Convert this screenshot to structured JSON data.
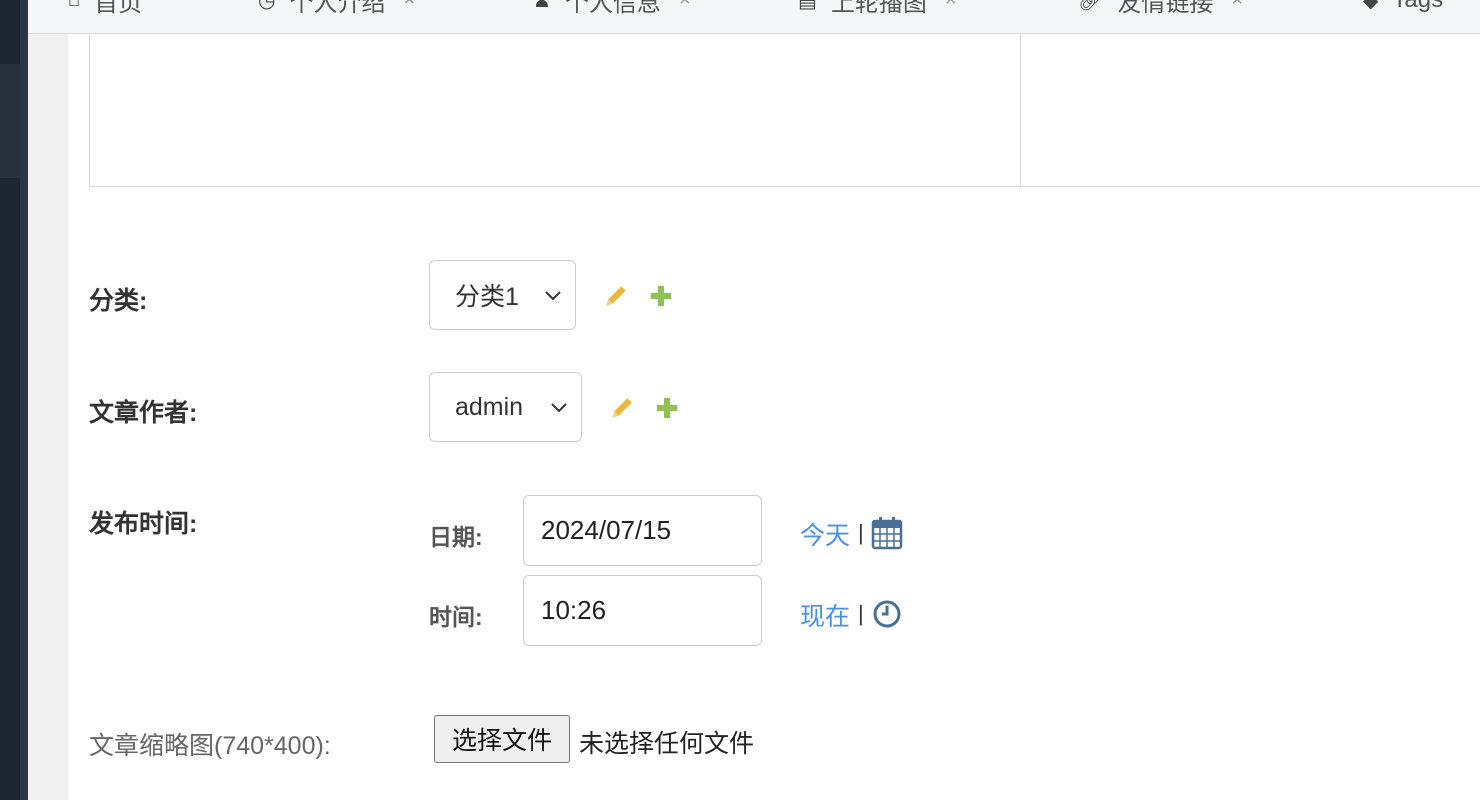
{
  "tabs": [
    {
      "label": "首页",
      "icon": "home-icon"
    },
    {
      "label": "个人介绍",
      "icon": "clock-icon",
      "closable": true
    },
    {
      "label": "个人信息",
      "icon": "user-icon",
      "closable": true
    },
    {
      "label": "上轮播图",
      "icon": "image-icon",
      "closable": true
    },
    {
      "label": "友情链接",
      "icon": "link-icon",
      "closable": true
    },
    {
      "label": "Tags",
      "icon": "tags-icon"
    }
  ],
  "form": {
    "category": {
      "label": "分类:",
      "value": "分类1"
    },
    "author": {
      "label": "文章作者:",
      "value": "admin"
    },
    "publish_time": {
      "label": "发布时间:",
      "date_label": "日期:",
      "date_value": "2024/07/15",
      "today_link": "今天",
      "time_label": "时间:",
      "time_value": "10:26",
      "now_link": "现在",
      "separator": "|"
    },
    "thumbnail": {
      "label": "文章缩略图(740*400):",
      "button": "选择文件",
      "status": "未选择任何文件"
    }
  },
  "colors": {
    "link": "#4a90e2",
    "edit_icon": "#e8b83a",
    "add_icon": "#8dc152",
    "sidebar": "#1d2733"
  }
}
